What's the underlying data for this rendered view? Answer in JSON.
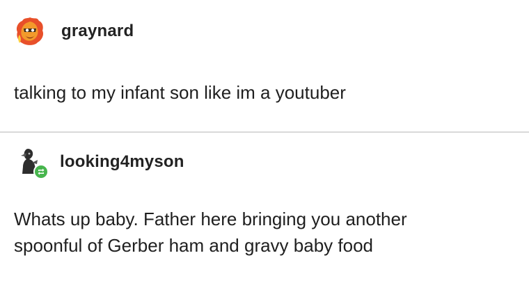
{
  "posts": [
    {
      "username": "graynard",
      "avatar_icon": "flaming-face-icon",
      "lines": [
        "talking to my infant son like im a youtuber"
      ]
    },
    {
      "username": "looking4myson",
      "avatar_icon": "dark-figure-icon",
      "badge_icon": "reblog-icon",
      "lines": [
        "Whats up baby. Father here bringing you another",
        "spoonful of Gerber ham and gravy baby food"
      ]
    }
  ],
  "colors": {
    "badge": "#47b54d",
    "divider": "#d9d9d9"
  }
}
